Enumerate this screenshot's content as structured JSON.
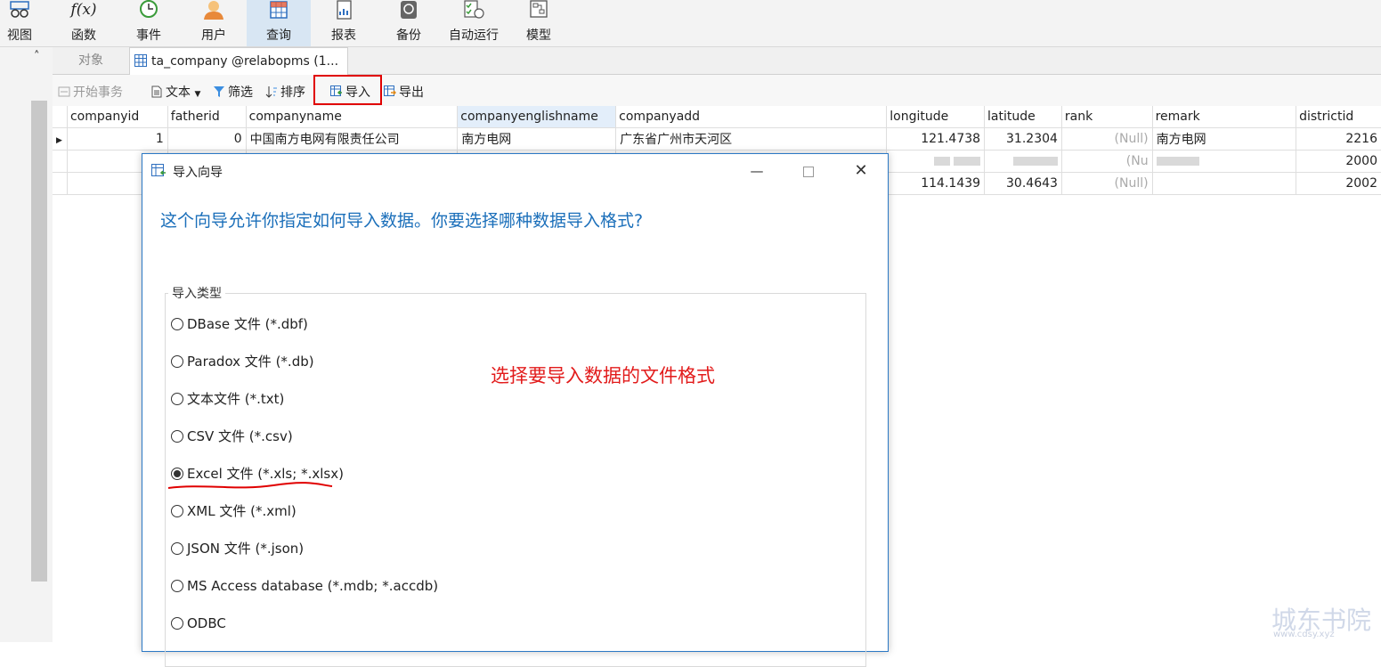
{
  "ribbon": {
    "items": [
      {
        "label": "视图",
        "icon": "view-icon"
      },
      {
        "label": "函数",
        "icon": "function-icon",
        "glyph": "f(x)"
      },
      {
        "label": "事件",
        "icon": "clock-icon"
      },
      {
        "label": "用户",
        "icon": "user-icon"
      },
      {
        "label": "查询",
        "icon": "query-icon"
      },
      {
        "label": "报表",
        "icon": "report-icon"
      },
      {
        "label": "备份",
        "icon": "backup-icon"
      },
      {
        "label": "自动运行",
        "icon": "schedule-icon"
      },
      {
        "label": "模型",
        "icon": "model-icon"
      }
    ],
    "active_index": 4
  },
  "tabs": {
    "objects": "对象",
    "active": "ta_company @relabopms (1..."
  },
  "toolbar": {
    "begin_tx": "开始事务",
    "text": "文本",
    "filter": "筛选",
    "sort": "排序",
    "import": "导入",
    "export": "导出"
  },
  "grid": {
    "columns": [
      "companyid",
      "fatherid",
      "companyname",
      "companyenglishname",
      "companyadd",
      "longitude",
      "latitude",
      "rank",
      "remark",
      "districtid"
    ],
    "rows": [
      {
        "companyid": "1",
        "fatherid": "0",
        "companyname": "中国南方电网有限责任公司",
        "companyenglishname": "南方电网",
        "companyadd": "广东省广州市天河区",
        "longitude": "121.4738",
        "latitude": "31.2304",
        "rank": "(Null)",
        "remark": "南方电网",
        "districtid": "2216"
      },
      {
        "companyid": "",
        "fatherid": "",
        "companyname": "",
        "companyenglishname": "",
        "companyadd": "",
        "longitude": "",
        "latitude": "",
        "rank": "(Nu",
        "remark": "",
        "districtid": "2000"
      },
      {
        "companyid": "",
        "fatherid": "",
        "companyname": "",
        "companyenglishname": "",
        "companyadd": "",
        "longitude": "114.1439",
        "latitude": "30.4643",
        "rank": "(Null)",
        "remark": "",
        "districtid": "2002"
      }
    ]
  },
  "dialog": {
    "title": "导入向导",
    "lead": "这个向导允许你指定如何导入数据。你要选择哪种数据导入格式?",
    "group_label": "导入类型",
    "options": [
      "DBase 文件 (*.dbf)",
      "Paradox 文件 (*.db)",
      "文本文件 (*.txt)",
      "CSV 文件 (*.csv)",
      "Excel 文件 (*.xls; *.xlsx)",
      "XML 文件 (*.xml)",
      "JSON 文件 (*.json)",
      "MS Access database (*.mdb; *.accdb)",
      "ODBC"
    ],
    "selected_index": 4,
    "annotation": "选择要导入数据的文件格式"
  },
  "watermark": {
    "title": "城东书院",
    "url": "www.cdsy.xyz"
  },
  "colors": {
    "accent": "#1b6fba",
    "highlight": "#e00000",
    "annotation": "#e21b1b",
    "null_text": "#aaaaaa"
  }
}
